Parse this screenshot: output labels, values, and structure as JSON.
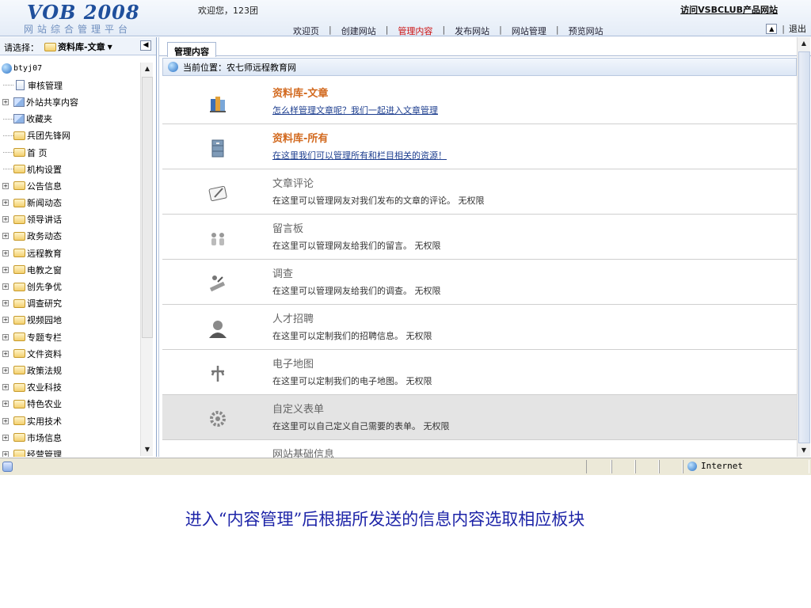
{
  "header": {
    "logo_title": "VOB 2008",
    "logo_subtitle": "网站综合管理平台",
    "welcome": "欢迎您，123团",
    "nav_items": [
      "欢迎页",
      "创建网站",
      "管理内容",
      "发布网站",
      "网站管理",
      "预览网站"
    ],
    "active_nav": "管理内容",
    "visit_link": "访问VSBCLUB产品网站",
    "logout": "退出"
  },
  "sidebar": {
    "select_label": "请选择：",
    "select_value": "资料库-文章",
    "root": "btyj07",
    "items": [
      {
        "label": "审核管理",
        "icon": "doc-icon",
        "expandable": false
      },
      {
        "label": "外站共享内容",
        "icon": "image-icon",
        "expandable": true
      },
      {
        "label": "收藏夹",
        "icon": "image-icon",
        "expandable": false
      },
      {
        "label": "兵团先锋网",
        "icon": "folder-icon",
        "expandable": false
      },
      {
        "label": "首 页",
        "icon": "folder-icon",
        "expandable": false
      },
      {
        "label": "机构设置",
        "icon": "folder-icon",
        "expandable": false
      },
      {
        "label": "公告信息",
        "icon": "folder-icon",
        "expandable": true
      },
      {
        "label": "新闻动态",
        "icon": "folder-icon",
        "expandable": true
      },
      {
        "label": "领导讲话",
        "icon": "folder-icon",
        "expandable": true
      },
      {
        "label": "政务动态",
        "icon": "folder-icon",
        "expandable": true
      },
      {
        "label": "远程教育",
        "icon": "folder-icon",
        "expandable": true
      },
      {
        "label": "电教之窗",
        "icon": "folder-icon",
        "expandable": true
      },
      {
        "label": "创先争优",
        "icon": "folder-icon",
        "expandable": true
      },
      {
        "label": "调查研究",
        "icon": "folder-icon",
        "expandable": true
      },
      {
        "label": "视频园地",
        "icon": "folder-icon",
        "expandable": true
      },
      {
        "label": "专题专栏",
        "icon": "folder-icon",
        "expandable": true
      },
      {
        "label": "文件资料",
        "icon": "folder-icon",
        "expandable": true
      },
      {
        "label": "政策法规",
        "icon": "folder-icon",
        "expandable": true
      },
      {
        "label": "农业科技",
        "icon": "folder-icon",
        "expandable": true
      },
      {
        "label": "特色农业",
        "icon": "folder-icon",
        "expandable": true
      },
      {
        "label": "实用技术",
        "icon": "folder-icon",
        "expandable": true
      },
      {
        "label": "市场信息",
        "icon": "folder-icon",
        "expandable": true
      },
      {
        "label": "经营管理",
        "icon": "folder-icon",
        "expandable": true
      }
    ]
  },
  "main": {
    "tab": "管理内容",
    "location_label": "当前位置：农七师远程教育网",
    "sections": [
      {
        "title": "资料库-文章",
        "desc": "怎么样管理文章呢？我们一起进入文章管理",
        "enabled": true,
        "icon": "books-icon"
      },
      {
        "title": "资料库-所有",
        "desc": "在这里我们可以管理所有和栏目相关的资源！",
        "enabled": true,
        "icon": "cabinet-icon"
      },
      {
        "title": "文章评论",
        "desc": "在这里可以管理网友对我们发布的文章的评论。 无权限",
        "enabled": false,
        "icon": "comment-icon"
      },
      {
        "title": "留言板",
        "desc": "在这里可以管理网友给我们的留言。 无权限",
        "enabled": false,
        "icon": "users-icon"
      },
      {
        "title": "调查",
        "desc": "在这里可以管理网友给我们的调查。 无权限",
        "enabled": false,
        "icon": "survey-icon"
      },
      {
        "title": "人才招聘",
        "desc": "在这里可以定制我们的招聘信息。 无权限",
        "enabled": false,
        "icon": "person-icon"
      },
      {
        "title": "电子地图",
        "desc": "在这里可以定制我们的电子地图。 无权限",
        "enabled": false,
        "icon": "map-pin-icon"
      },
      {
        "title": "自定义表单",
        "desc": "在这里可以自己定义自己需要的表单。 无权限",
        "enabled": false,
        "icon": "gear-icon",
        "shaded": true
      },
      {
        "title": "网站基础信息",
        "desc": "",
        "enabled": false,
        "icon": "info-icon"
      }
    ]
  },
  "statusbar": {
    "zone": "Internet"
  },
  "caption": "进入“内容管理”后根据所发送的信息内容选取相应板块"
}
